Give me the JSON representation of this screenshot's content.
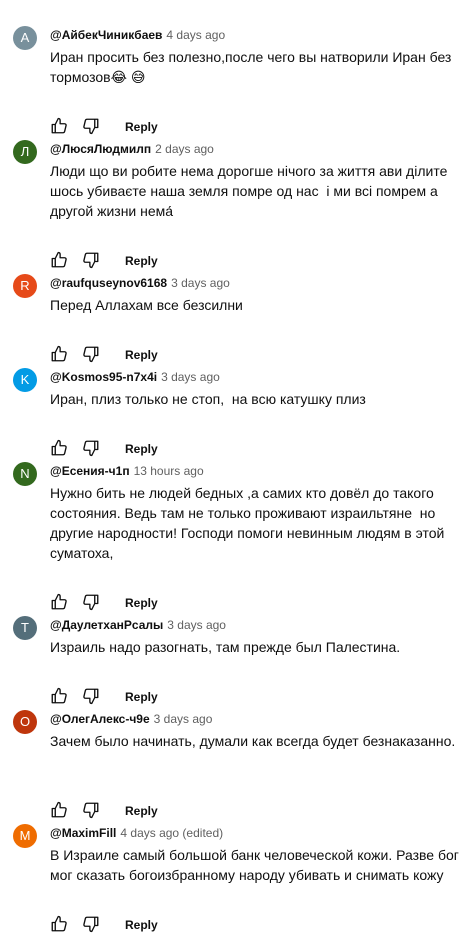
{
  "comments": [
    {
      "initial": "А",
      "avatar_color": "#78909c",
      "author": "@АйбекЧиникбаев",
      "time": "4 days ago",
      "text": "Иран просить без полезно,после чего вы натворили Иран без тормозов😂 😅"
    },
    {
      "initial": "Л",
      "avatar_color": "#33691e",
      "author": "@ЛюсяЛюдмилп",
      "time": "2 days ago",
      "text": "Люди що ви робите нема дорогше нічого за життя ави ділите шось убиваєте наша земля помре од нас  і ми всі помрем а другой жизни нема́"
    },
    {
      "initial": "R",
      "avatar_color": "#e64a19",
      "author": "@raufquseynov6168",
      "time": "3 days ago",
      "text": "Перед Аллахам все безсилни"
    },
    {
      "initial": "K",
      "avatar_color": "#039be5",
      "author": "@Kosmos95-n7x4i",
      "time": "3 days ago",
      "text": "Иран, плиз только не стоп,  на всю катушку плиз"
    },
    {
      "initial": "N",
      "avatar_color": "#33691e",
      "author": "@Есения-ч1п",
      "time": "13 hours ago",
      "text": "Нужно бить не людей бедных ,а самих кто довёл до такого состояния. Ведь там не только проживают израильтяне  но другие народности! Господи помоги невинным людям в этой суматоха,"
    },
    {
      "initial": "T",
      "avatar_color": "#546e7a",
      "author": "@ДаулетханРсалы",
      "time": "3 days ago",
      "text": "Израиль надо разогнать, там прежде был Палестина."
    },
    {
      "initial": "O",
      "avatar_color": "#bf360c",
      "author": "@ОлегАлекс-ч9е",
      "time": "3 days ago",
      "text": "Зачем было начинать, думали как всегда будет безнаказанно."
    },
    {
      "initial": "M",
      "avatar_color": "#ef6c00",
      "author": "@MaximFill",
      "time": "4 days ago (edited)",
      "text": "В Израиле самый большой банк человеческой кожи. Разве бог мог сказать богоизбранному народу убивать и снимать кожу"
    }
  ],
  "reply_label": "Reply",
  "icons": {
    "like": "thumbs-up-icon",
    "dislike": "thumbs-down-icon"
  }
}
